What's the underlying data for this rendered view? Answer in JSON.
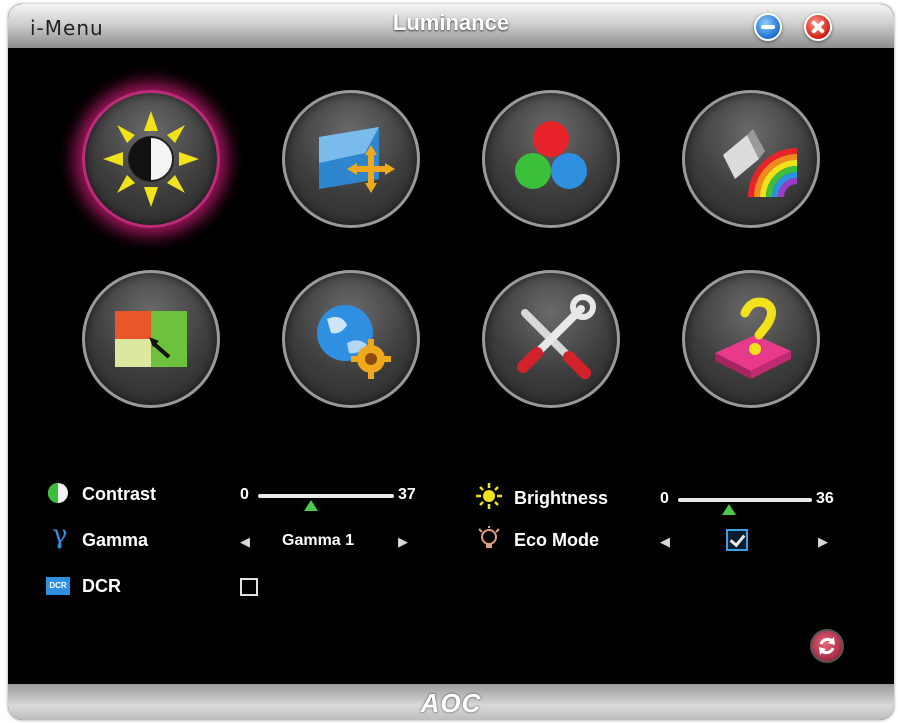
{
  "window": {
    "app_name": "i-Menu",
    "title": "Luminance",
    "brand": "AOC"
  },
  "titlebar_buttons": [
    {
      "name": "minimize",
      "icon": "minimize-icon",
      "color": "#1a6fd0"
    },
    {
      "name": "close",
      "icon": "close-icon",
      "color": "#d21d12"
    }
  ],
  "menu_tiles": [
    {
      "icon": "luminance-sun-icon",
      "active": true
    },
    {
      "icon": "image-setup-icon",
      "active": false
    },
    {
      "icon": "color-setup-icon",
      "active": false
    },
    {
      "icon": "picture-boost-icon",
      "active": false
    },
    {
      "icon": "osd-setup-icon",
      "active": false
    },
    {
      "icon": "extra-globe-icon",
      "active": false
    },
    {
      "icon": "tools-icon",
      "active": false
    },
    {
      "icon": "exit-icon",
      "active": false
    }
  ],
  "settings": {
    "contrast": {
      "label": "Contrast",
      "min": "0",
      "value": "37",
      "icon": "contrast-icon"
    },
    "brightness": {
      "label": "Brightness",
      "min": "0",
      "value": "36",
      "icon": "brightness-icon"
    },
    "gamma": {
      "label": "Gamma",
      "value": "Gamma 1",
      "icon": "gamma-icon"
    },
    "eco_mode": {
      "label": "Eco Mode",
      "checked": true,
      "icon": "eco-mode-icon"
    },
    "dcr": {
      "label": "DCR",
      "checked": false,
      "icon_text": "DCR",
      "icon": "dcr-icon"
    }
  },
  "reset_button": {
    "icon": "reset-icon"
  },
  "colors": {
    "active_glow": "#c02a7a",
    "slider_thumb": "#4cc94a",
    "checkbox_accent": "#3aa0e8"
  }
}
